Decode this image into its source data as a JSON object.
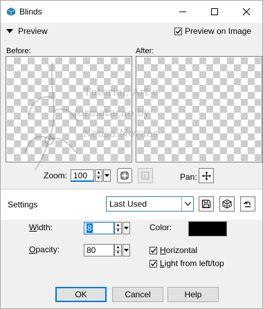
{
  "window": {
    "title": "Blinds",
    "app_icon": "blinds-app-icon"
  },
  "preview": {
    "toggle_label": "Preview",
    "preview_on_image_label": "Preview on Image",
    "preview_on_image_checked": true,
    "before_label": "Before:",
    "after_label": "After:",
    "watermark_lines": [
      "Tutorial, Art e",
      "formatação by",
      "Neusa Novaes"
    ]
  },
  "zoom": {
    "label": "Zoom:",
    "value": "100"
  },
  "pan": {
    "label": "Pan:"
  },
  "settings": {
    "label": "Settings",
    "preset_value": "Last Used"
  },
  "fields": {
    "width_label": "Width:",
    "width_value": "8",
    "opacity_label": "Opacity:",
    "opacity_value": "80",
    "color_label": "Color:",
    "color_value": "#000000"
  },
  "options": {
    "horizontal_label": "Horizontal",
    "horizontal_checked": true,
    "light_label": "Light from left/top",
    "light_checked": true
  },
  "buttons": {
    "ok": "OK",
    "cancel": "Cancel",
    "help": "Help"
  },
  "colors": {
    "accent": "#0078d7",
    "window_bg": "#f0f0f0",
    "checker": "#cdcdcd"
  }
}
